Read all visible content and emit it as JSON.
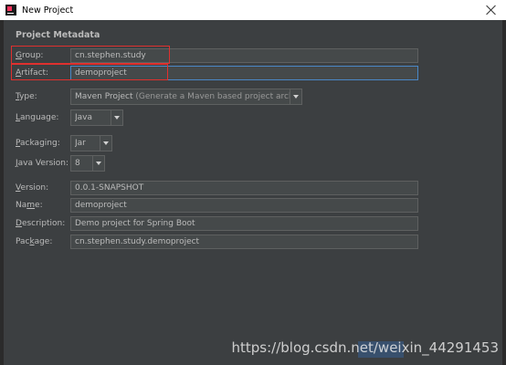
{
  "window": {
    "title": "New Project"
  },
  "section": {
    "title": "Project Metadata"
  },
  "fields": {
    "group": {
      "label_mn": "G",
      "label_rest": "roup:",
      "value": "cn.stephen.study"
    },
    "artifact": {
      "label_mn": "A",
      "label_rest": "rtifact:",
      "value": "demoproject"
    },
    "type": {
      "label_mn": "T",
      "label_rest": "ype:",
      "value": "Maven Project",
      "desc": "(Generate a Maven based project archive)"
    },
    "language": {
      "label_mn": "L",
      "label_rest": "anguage:",
      "value": "Java"
    },
    "packaging": {
      "label_mn": "P",
      "label_rest": "ackaging:",
      "value": "Jar"
    },
    "java_version": {
      "label_mn": "J",
      "label_rest": "ava Version:",
      "value": "8"
    },
    "version": {
      "label_mn": "V",
      "label_rest": "ersion:",
      "value": "0.0.1-SNAPSHOT"
    },
    "name": {
      "label_pre": "Na",
      "label_mn": "m",
      "label_rest": "e:",
      "value": "demoproject"
    },
    "description": {
      "label_mn": "D",
      "label_rest": "escription:",
      "value": "Demo project for Spring Boot"
    },
    "package": {
      "label_pre": "Pac",
      "label_mn": "k",
      "label_rest": "age:",
      "value": "cn.stephen.study.demoproject"
    }
  },
  "watermark": "https://blog.csdn.net/weixin_44291453",
  "colors": {
    "background": "#3c3f41",
    "field": "#45494a",
    "focus": "#4a88c7",
    "annotation": "#e0302e"
  }
}
